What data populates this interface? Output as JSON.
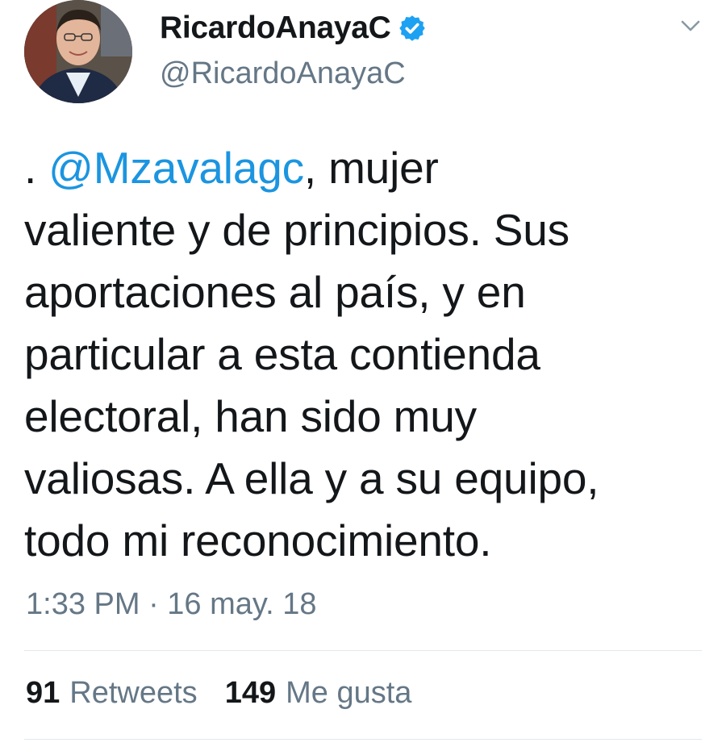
{
  "tweet": {
    "display_name": "RicardoAnayaC",
    "handle": "@RicardoAnayaC",
    "verified": true,
    "icons": {
      "verified": "verified-badge-icon",
      "caret": "chevron-down-icon",
      "avatar": "profile-photo"
    },
    "colors": {
      "mention": "#1b95e0",
      "verified": "#1da1f2",
      "secondary_text": "#657786"
    },
    "text": {
      "prefix": ". ",
      "mention": "@Mzavalagc",
      "line1_rest": ", mujer",
      "line2": "valiente y de principios. Sus",
      "line3": "aportaciones al país, y en",
      "line4": "particular a esta contienda",
      "line5": "electoral, han sido muy",
      "line6": "valiosas. A ella y a su equipo,",
      "line7": "todo mi reconocimiento."
    },
    "timestamp": "1:33 PM · 16 may. 18",
    "stats": {
      "retweets_count": "91",
      "retweets_label": "Retweets",
      "likes_count": "149",
      "likes_label": "Me gusta"
    }
  }
}
